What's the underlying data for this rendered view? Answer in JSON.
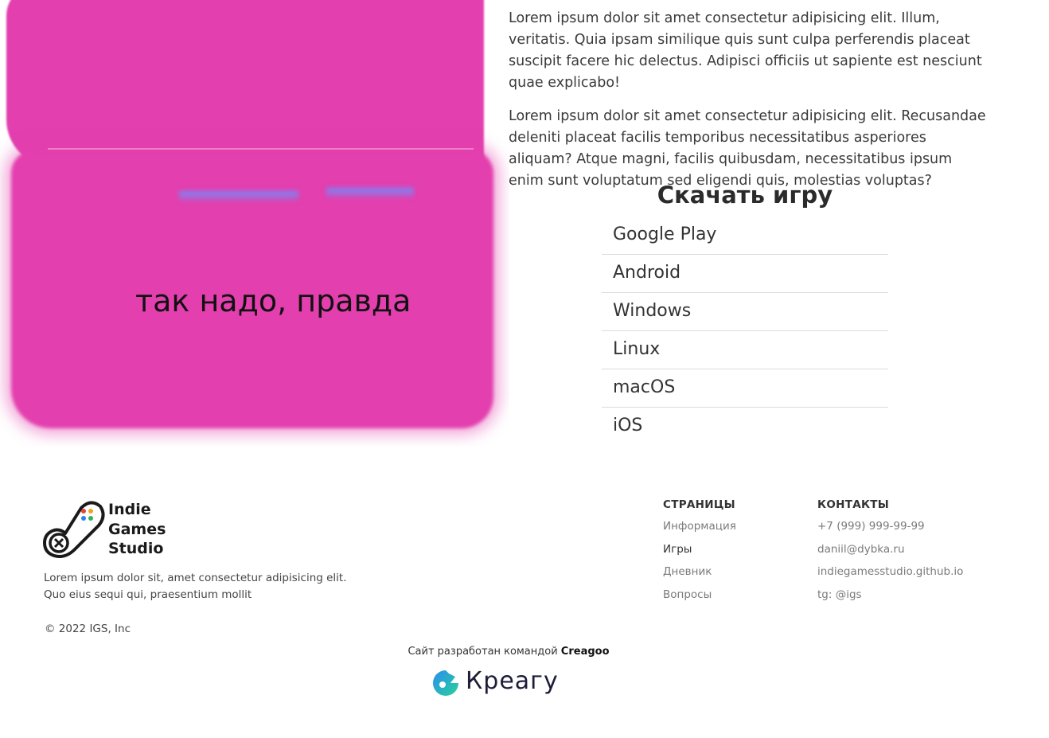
{
  "hero": {
    "caption": "так надо, правда",
    "image_colors": {
      "pink": "#e33fae",
      "streak": "#6f8cff"
    }
  },
  "article": {
    "paragraphs": [
      "Lorem ipsum dolor sit amet consectetur adipisicing elit. Illum, veritatis. Quia ipsam similique quis sunt culpa perferendis placeat suscipit facere hic delectus. Adipisci officiis ut sapiente est nesciunt quae explicabo!",
      "Lorem ipsum dolor sit amet consectetur adipisicing elit. Recusandae deleniti placeat facilis temporibus necessitatibus asperiores aliquam? Atque magni, facilis quibusdam, necessitatibus ipsum enim sunt voluptatum sed eligendi quis, molestias voluptas?"
    ]
  },
  "download": {
    "title": "Скачать игру",
    "platforms": [
      "Google Play",
      "Android",
      "Windows",
      "Linux",
      "macOS",
      "iOS"
    ]
  },
  "footer": {
    "logo_lines": [
      "Indie",
      "Games",
      "Studio"
    ],
    "logo_icon": "gamepad-icon",
    "description": "Lorem ipsum dolor sit, amet consectetur adipisicing elit. Quo eius sequi qui, praesentium mollit",
    "copyright": "© 2022 IGS, Inc",
    "pages": {
      "heading": "СТРАНИЦЫ",
      "links": [
        "Информация",
        "Игры",
        "Дневник",
        "Вопросы"
      ]
    },
    "contacts": {
      "heading": "КОНТАКТЫ",
      "links": [
        "+7 (999) 999-99-99",
        "daniil@dybka.ru",
        "indiegamesstudio.github.io",
        "tg: @igs"
      ]
    },
    "credit_prefix": "Сайт разработан командой",
    "credit_name": "Creagoo",
    "creagoo_wordmark": "Креагу"
  }
}
